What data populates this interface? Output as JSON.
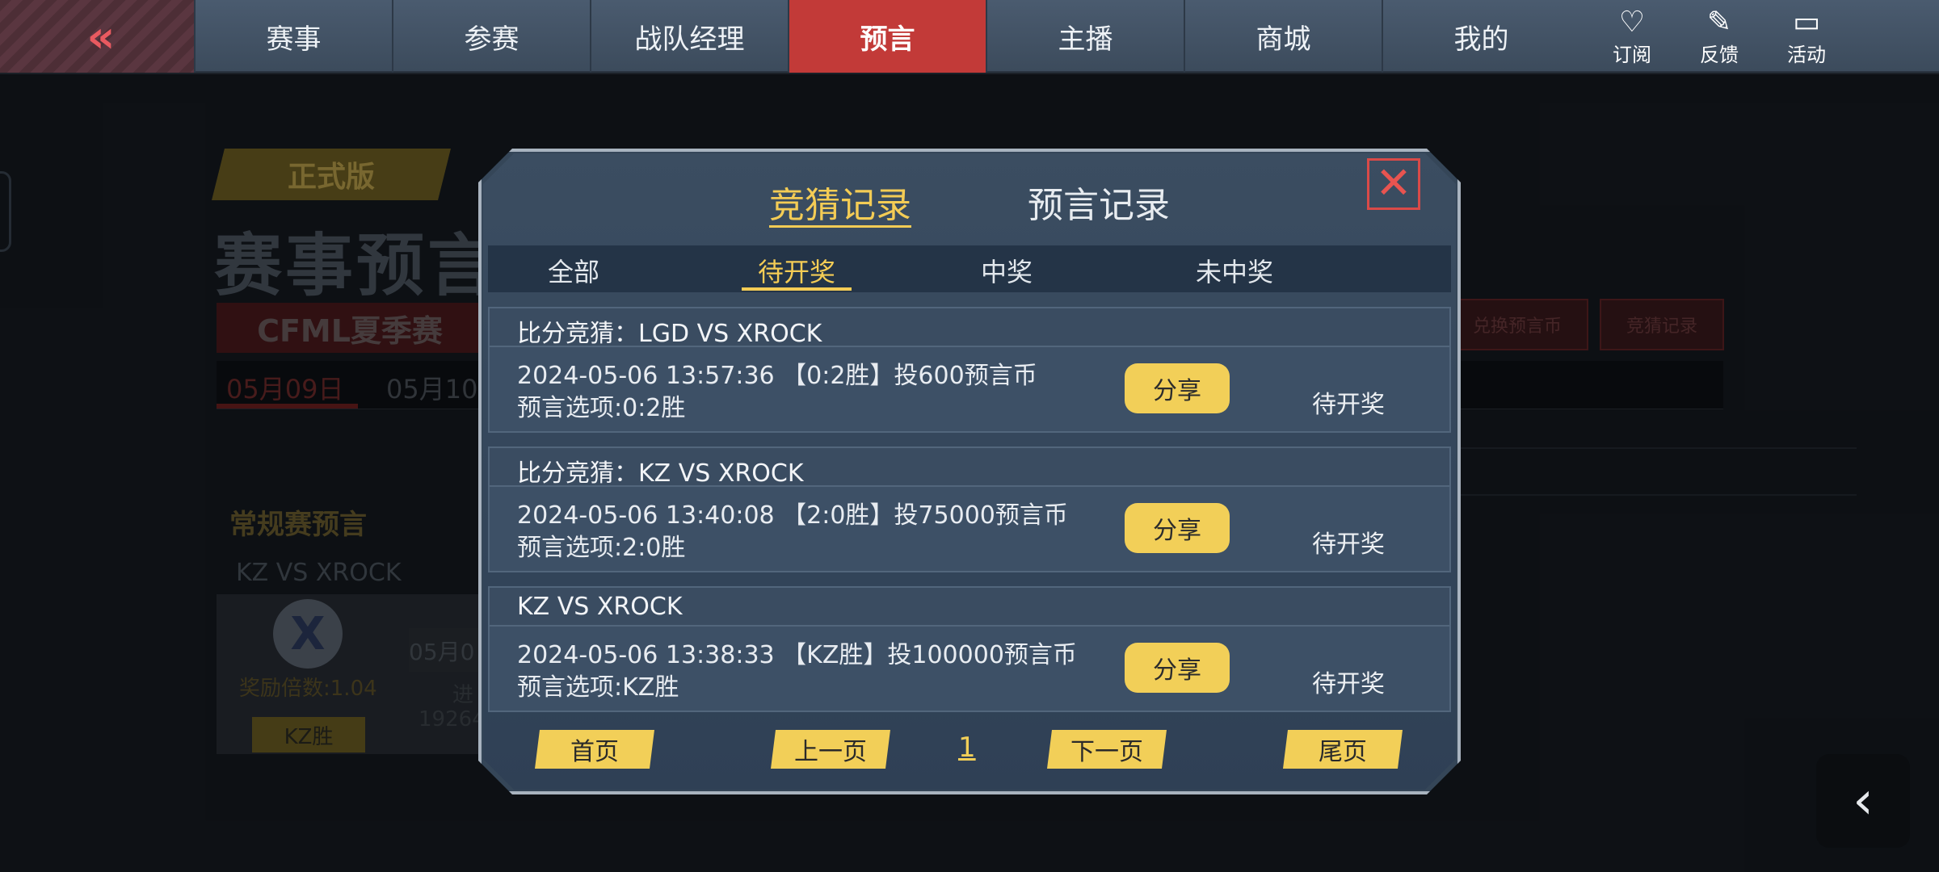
{
  "nav": {
    "back_glyph": "«",
    "tabs": [
      {
        "label": "赛事"
      },
      {
        "label": "参赛"
      },
      {
        "label": "战队经理"
      },
      {
        "label": "预言"
      },
      {
        "label": "主播"
      },
      {
        "label": "商城"
      },
      {
        "label": "我的"
      }
    ],
    "active_tab": "预言",
    "icons": [
      {
        "name": "subscribe-icon",
        "glyph": "♡",
        "label": "订阅"
      },
      {
        "name": "feedback-icon",
        "glyph": "✎",
        "label": "反馈"
      },
      {
        "name": "activity-icon",
        "glyph": "▭",
        "label": "活动"
      }
    ]
  },
  "background": {
    "version_badge": "正式版",
    "title": "赛事预言",
    "league": "CFML夏季赛",
    "dates": [
      "05月09日",
      "05月10"
    ],
    "section": "常规赛预言",
    "match": "KZ VS XROCK",
    "team_logo": "X",
    "reward": "奖励倍数:1.04",
    "team_button": "KZ胜",
    "small_date": "05月0",
    "small_a": "进",
    "small_b": "19264",
    "exchange_button": "兑换预言币",
    "record_button": "竞猜记录"
  },
  "modal": {
    "tabs": {
      "active": "竞猜记录",
      "inactive": "预言记录"
    },
    "close_glyph": "✕",
    "filters": [
      "全部",
      "待开奖",
      "中奖",
      "未中奖"
    ],
    "active_filter": "待开奖",
    "records": [
      {
        "title": "比分竞猜：LGD VS XROCK",
        "line1": "2024-05-06 13:57:36 【0:2胜】投600预言币",
        "line2": "预言选项:0:2胜",
        "share": "分享",
        "status": "待开奖"
      },
      {
        "title": "比分竞猜：KZ VS XROCK",
        "line1": "2024-05-06 13:40:08 【2:0胜】投75000预言币",
        "line2": "预言选项:2:0胜",
        "share": "分享",
        "status": "待开奖"
      },
      {
        "title": "KZ VS XROCK",
        "line1": "2024-05-06 13:38:33 【KZ胜】投100000预言币",
        "line2": "预言选项:KZ胜",
        "share": "分享",
        "status": "待开奖"
      }
    ],
    "pager": {
      "first": "首页",
      "prev": "上一页",
      "current": "1",
      "next": "下一页",
      "last": "尾页"
    }
  },
  "corner_back_glyph": "‹",
  "colors": {
    "accent_gold": "#f2cf58",
    "active_red": "#c23a38"
  }
}
